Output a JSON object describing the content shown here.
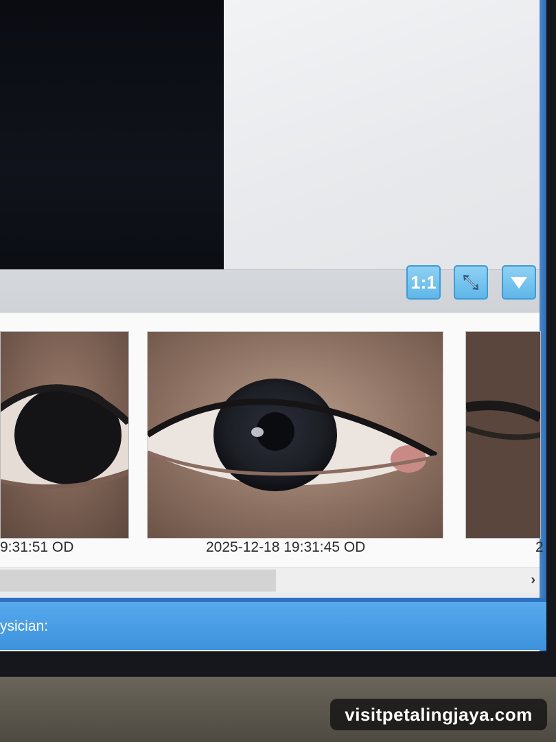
{
  "toolbar": {
    "ratio_label": "1:1",
    "fit_icon": "expand-arrows-icon",
    "menu_icon": "triangle-down-icon"
  },
  "thumbnails": [
    {
      "caption": "9:31:51 OD"
    },
    {
      "caption": "2025-12-18 19:31:45 OD"
    },
    {
      "caption": "2"
    }
  ],
  "scrollbar": {
    "arrow": "›"
  },
  "status_bar": {
    "label": "ysician:"
  },
  "watermark": "visitpetalingjaya.com",
  "colors": {
    "accent": "#5fb7e8",
    "status_bar": "#4a9fe6"
  }
}
